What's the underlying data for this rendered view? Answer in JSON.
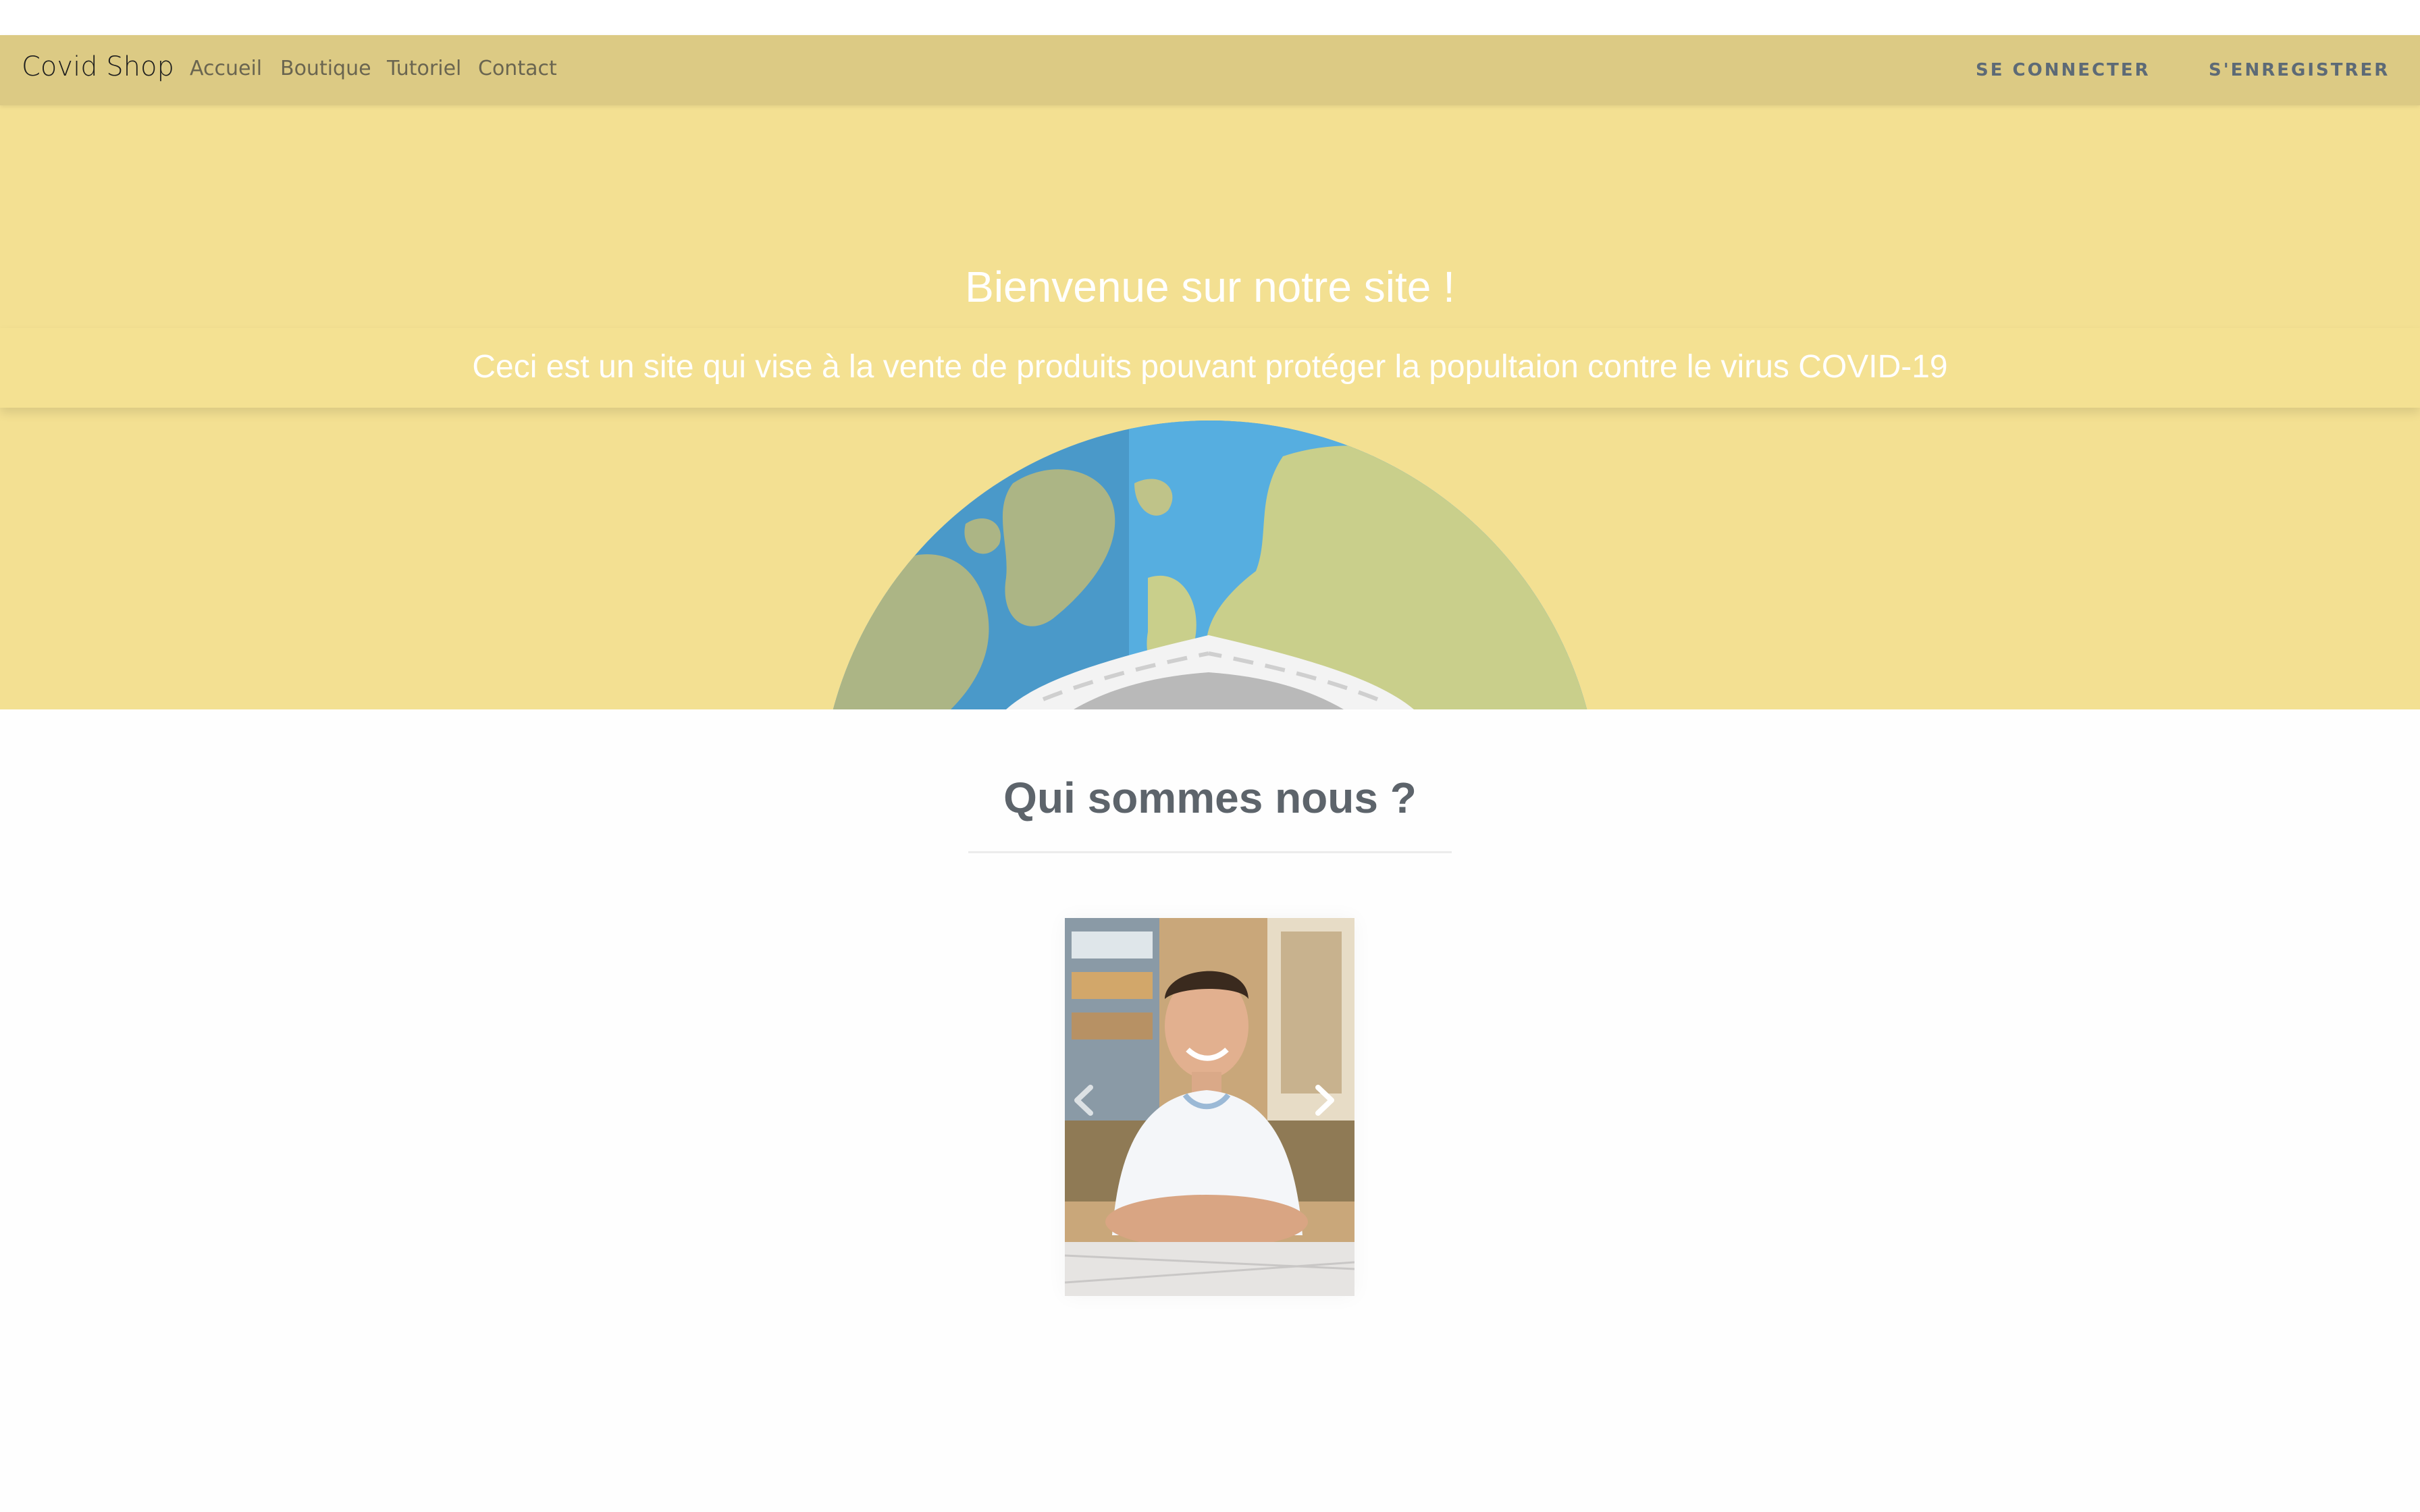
{
  "navbar": {
    "brand": "Covid Shop",
    "links": [
      {
        "label": "Accueil"
      },
      {
        "label": "Boutique"
      },
      {
        "label": "Tutoriel"
      },
      {
        "label": "Contact"
      }
    ],
    "login_label": "SE CONNECTER",
    "register_label": "S'ENREGISTRER"
  },
  "hero": {
    "title": "Bienvenue sur notre site !",
    "subtitle": "Ceci est un site qui vise à la vente de produits pouvant protéger la popultaion contre le virus COVID-19"
  },
  "about": {
    "title": "Qui sommes nous ?"
  },
  "icons": {
    "prev": "chevron-left-icon",
    "next": "chevron-right-icon"
  },
  "colors": {
    "navbar_bg": "#dcca84",
    "hero_bg": "#f3e092",
    "ocean": "#4fa3d6",
    "land": "#c9cf8b",
    "heading": "#5d646b"
  }
}
